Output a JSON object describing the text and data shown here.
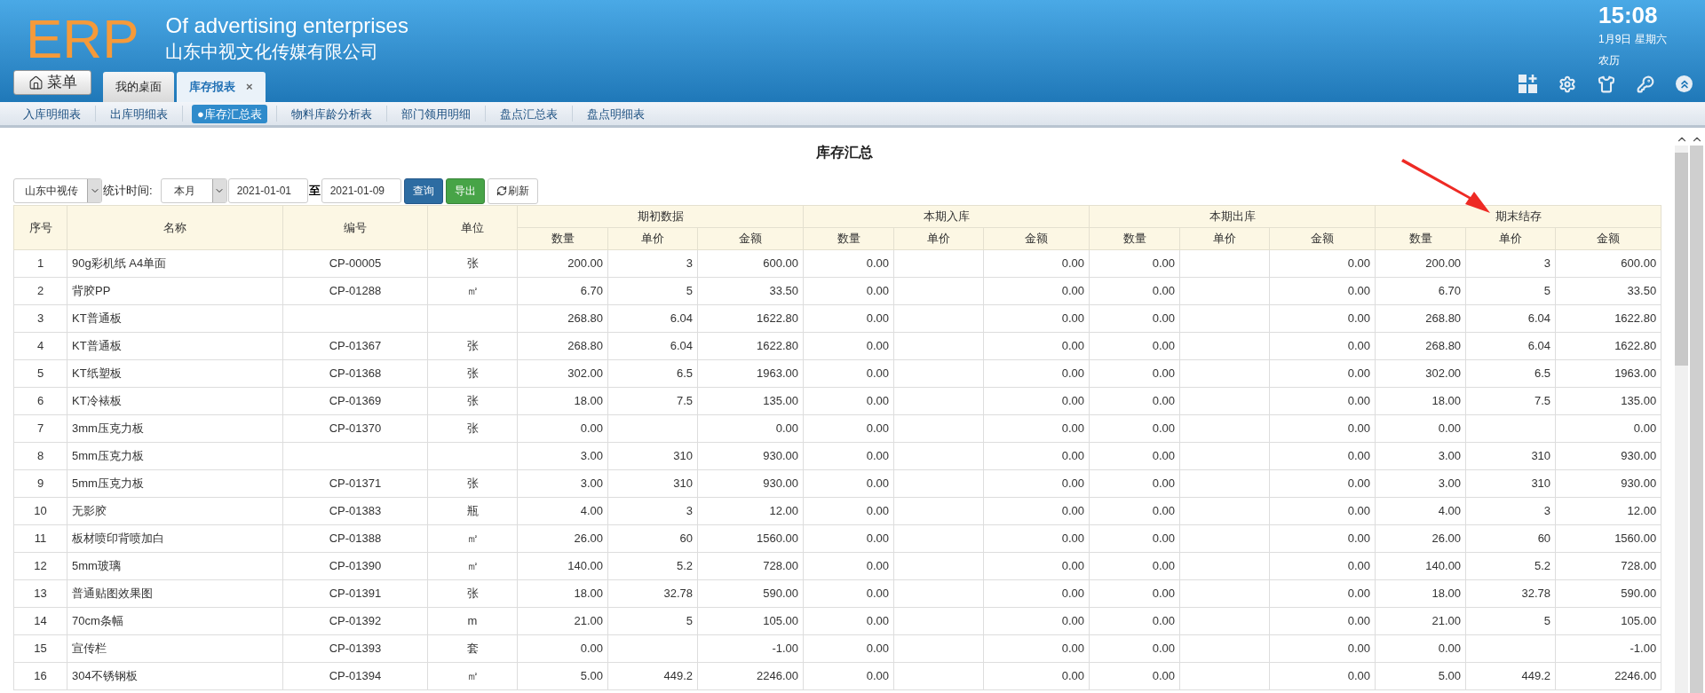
{
  "header": {
    "logo": "ERP",
    "title_en": "Of advertising enterprises",
    "title_cn": "山东中视文化传媒有限公司",
    "time": "15:08",
    "date": "1月9日 星期六",
    "lunar": "农历",
    "menu_button": "菜单"
  },
  "tabs": [
    {
      "label": "我的桌面",
      "selected": false,
      "closable": false
    },
    {
      "label": "库存报表",
      "selected": true,
      "closable": true
    }
  ],
  "close_mark": "×",
  "subnav": [
    {
      "label": "入库明细表",
      "selected": false
    },
    {
      "label": "出库明细表",
      "selected": false
    },
    {
      "label": "●库存汇总表",
      "selected": true
    },
    {
      "label": "物料库龄分析表",
      "selected": false
    },
    {
      "label": "部门领用明细",
      "selected": false
    },
    {
      "label": "盘点汇总表",
      "selected": false
    },
    {
      "label": "盘点明细表",
      "selected": false
    }
  ],
  "report_title": "库存汇总",
  "filters": {
    "company": "山东中视传",
    "period_label": "统计时间:",
    "period": "本月",
    "start_date": "2021-01-01",
    "to": "至",
    "end_date": "2021-01-09"
  },
  "buttons": [
    {
      "label": "查询",
      "kind": "primary"
    },
    {
      "label": "导出",
      "kind": "success"
    },
    {
      "label": "刷新",
      "kind": "refresh"
    }
  ],
  "table": {
    "columns": [
      "序号",
      "名称",
      "编号",
      "单位"
    ],
    "groups": [
      {
        "label": "期初数据",
        "columns": [
          "数量",
          "单价",
          "金额"
        ]
      },
      {
        "label": "本期入库",
        "columns": [
          "数量",
          "单价",
          "金额"
        ]
      },
      {
        "label": "本期出库",
        "columns": [
          "数量",
          "单价",
          "金额"
        ]
      },
      {
        "label": "期末结存",
        "columns": [
          "数量",
          "单价",
          "金额"
        ]
      }
    ],
    "rows": [
      [
        "1",
        "90g彩机纸 A4单面",
        "CP-00005",
        "张",
        "200.00",
        "3",
        "600.00",
        "0.00",
        "",
        "0.00",
        "0.00",
        "",
        "0.00",
        "200.00",
        "3",
        "600.00"
      ],
      [
        "2",
        "背胶PP",
        "CP-01288",
        "㎡",
        "6.70",
        "5",
        "33.50",
        "0.00",
        "",
        "0.00",
        "0.00",
        "",
        "0.00",
        "6.70",
        "5",
        "33.50"
      ],
      [
        "3",
        "KT普通板",
        "",
        "",
        "268.80",
        "6.04",
        "1622.80",
        "0.00",
        "",
        "0.00",
        "0.00",
        "",
        "0.00",
        "268.80",
        "6.04",
        "1622.80"
      ],
      [
        "4",
        "KT普通板",
        "CP-01367",
        "张",
        "268.80",
        "6.04",
        "1622.80",
        "0.00",
        "",
        "0.00",
        "0.00",
        "",
        "0.00",
        "268.80",
        "6.04",
        "1622.80"
      ],
      [
        "5",
        "KT纸塑板",
        "CP-01368",
        "张",
        "302.00",
        "6.5",
        "1963.00",
        "0.00",
        "",
        "0.00",
        "0.00",
        "",
        "0.00",
        "302.00",
        "6.5",
        "1963.00"
      ],
      [
        "6",
        "KT冷裱板",
        "CP-01369",
        "张",
        "18.00",
        "7.5",
        "135.00",
        "0.00",
        "",
        "0.00",
        "0.00",
        "",
        "0.00",
        "18.00",
        "7.5",
        "135.00"
      ],
      [
        "7",
        "3mm压克力板",
        "CP-01370",
        "张",
        "0.00",
        "",
        "0.00",
        "0.00",
        "",
        "0.00",
        "0.00",
        "",
        "0.00",
        "0.00",
        "",
        "0.00"
      ],
      [
        "8",
        "5mm压克力板",
        "",
        "",
        "3.00",
        "310",
        "930.00",
        "0.00",
        "",
        "0.00",
        "0.00",
        "",
        "0.00",
        "3.00",
        "310",
        "930.00"
      ],
      [
        "9",
        "5mm压克力板",
        "CP-01371",
        "张",
        "3.00",
        "310",
        "930.00",
        "0.00",
        "",
        "0.00",
        "0.00",
        "",
        "0.00",
        "3.00",
        "310",
        "930.00"
      ],
      [
        "10",
        "无影胶",
        "CP-01383",
        "瓶",
        "4.00",
        "3",
        "12.00",
        "0.00",
        "",
        "0.00",
        "0.00",
        "",
        "0.00",
        "4.00",
        "3",
        "12.00"
      ],
      [
        "11",
        "板材喷印背喷加白",
        "CP-01388",
        "㎡",
        "26.00",
        "60",
        "1560.00",
        "0.00",
        "",
        "0.00",
        "0.00",
        "",
        "0.00",
        "26.00",
        "60",
        "1560.00"
      ],
      [
        "12",
        "5mm玻璃",
        "CP-01390",
        "㎡",
        "140.00",
        "5.2",
        "728.00",
        "0.00",
        "",
        "0.00",
        "0.00",
        "",
        "0.00",
        "140.00",
        "5.2",
        "728.00"
      ],
      [
        "13",
        "普通贴图效果图",
        "CP-01391",
        "张",
        "18.00",
        "32.78",
        "590.00",
        "0.00",
        "",
        "0.00",
        "0.00",
        "",
        "0.00",
        "18.00",
        "32.78",
        "590.00"
      ],
      [
        "14",
        "70cm条幅",
        "CP-01392",
        "m",
        "21.00",
        "5",
        "105.00",
        "0.00",
        "",
        "0.00",
        "0.00",
        "",
        "0.00",
        "21.00",
        "5",
        "105.00"
      ],
      [
        "15",
        "宣传栏",
        "CP-01393",
        "套",
        "0.00",
        "",
        "-1.00",
        "0.00",
        "",
        "0.00",
        "0.00",
        "",
        "0.00",
        "0.00",
        "",
        "-1.00"
      ],
      [
        "16",
        "304不锈钢板",
        "CP-01394",
        "㎡",
        "5.00",
        "449.2",
        "2246.00",
        "0.00",
        "",
        "0.00",
        "0.00",
        "",
        "0.00",
        "5.00",
        "449.2",
        "2246.00"
      ]
    ]
  }
}
